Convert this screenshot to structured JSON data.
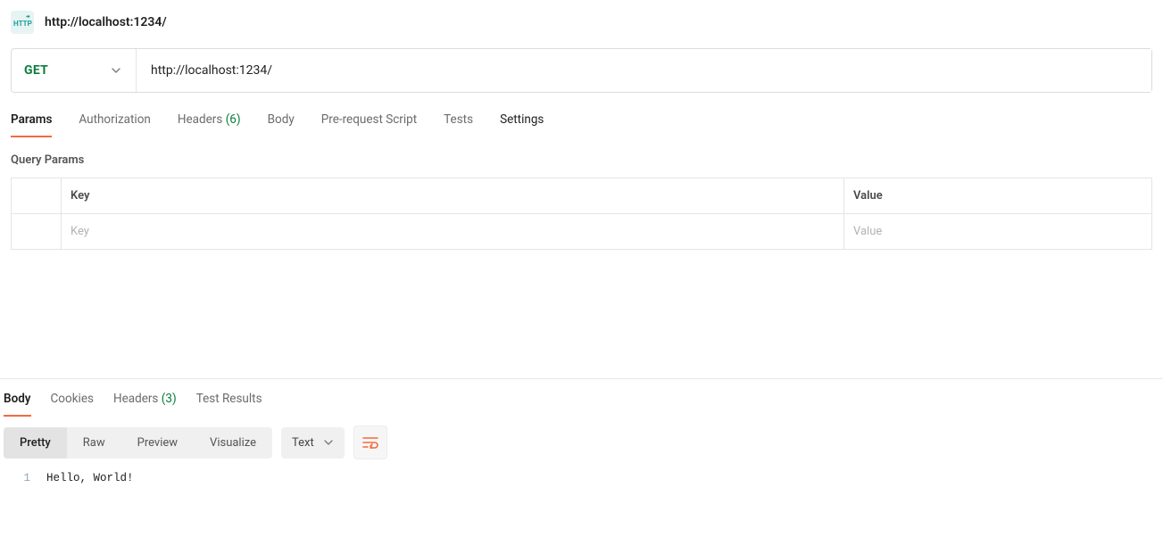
{
  "header": {
    "title": "http://localhost:1234/"
  },
  "request": {
    "method": "GET",
    "url": "http://localhost:1234/"
  },
  "requestTabs": {
    "params": "Params",
    "authorization": "Authorization",
    "headers": "Headers",
    "headersCount": "(6)",
    "body": "Body",
    "preRequest": "Pre-request Script",
    "tests": "Tests",
    "settings": "Settings"
  },
  "queryParams": {
    "sectionLabel": "Query Params",
    "keyHeader": "Key",
    "valueHeader": "Value",
    "keyPlaceholder": "Key",
    "valuePlaceholder": "Value"
  },
  "responseTabs": {
    "body": "Body",
    "cookies": "Cookies",
    "headers": "Headers",
    "headersCount": "(3)",
    "testResults": "Test Results"
  },
  "responseView": {
    "pretty": "Pretty",
    "raw": "Raw",
    "preview": "Preview",
    "visualize": "Visualize",
    "lang": "Text"
  },
  "responseBody": {
    "lineNumber": "1",
    "line1": "Hello, World!"
  }
}
